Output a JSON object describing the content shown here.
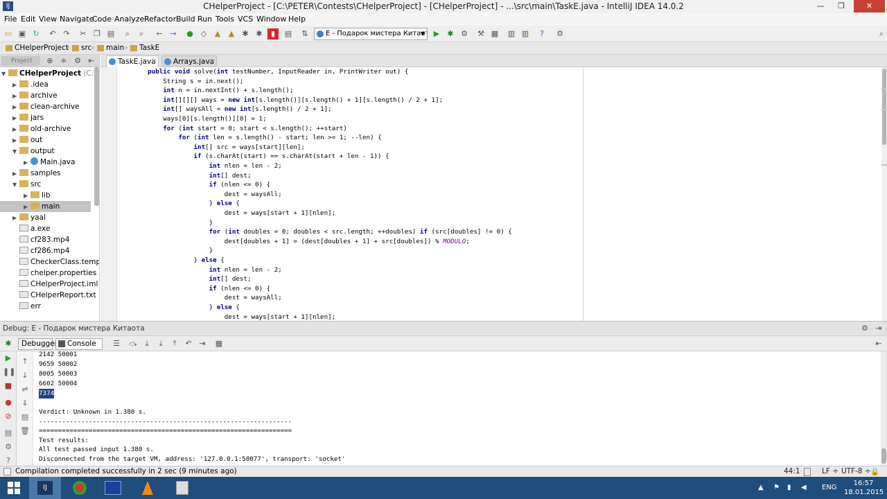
{
  "window": {
    "title": "CHelperProject - [C:\\PETER\\Contests\\CHelperProject] - [CHelperProject] - ...\\src\\main\\TaskE.java - IntelliJ IDEA 14.0.2",
    "minimize": "—",
    "maximize": "❐",
    "close": "✕"
  },
  "menu": [
    "File",
    "Edit",
    "View",
    "Navigate",
    "Code",
    "Analyze",
    "Refactor",
    "Build",
    "Run",
    "Tools",
    "VCS",
    "Window",
    "Help"
  ],
  "toolbar": {
    "run_config": "E - Подарок мистера Китаота"
  },
  "breadcrumb": [
    "CHelperProject",
    "src",
    "main",
    "TaskE"
  ],
  "project_panel": {
    "tab_label": "Project",
    "tree": [
      {
        "label": "CHelperProject",
        "suffix": "(C:\\PET",
        "type": "folder",
        "arrow": "▼"
      },
      {
        "label": ".idea",
        "type": "folder",
        "arrow": "▶"
      },
      {
        "label": "archive",
        "type": "folder",
        "arrow": "▶"
      },
      {
        "label": "clean-archive",
        "type": "folder",
        "arrow": "▶"
      },
      {
        "label": "jars",
        "type": "folder",
        "arrow": "▶"
      },
      {
        "label": "old-archive",
        "type": "folder",
        "arrow": "▶"
      },
      {
        "label": "out",
        "type": "folder",
        "arrow": "▶"
      },
      {
        "label": "output",
        "type": "folder",
        "arrow": "▼"
      },
      {
        "label": "Main.java",
        "type": "java",
        "arrow": "▶"
      },
      {
        "label": "samples",
        "type": "folder",
        "arrow": "▶"
      },
      {
        "label": "src",
        "type": "folder",
        "arrow": "▼"
      },
      {
        "label": "lib",
        "type": "folder",
        "arrow": "▶"
      },
      {
        "label": "main",
        "type": "folder",
        "arrow": "▶",
        "selected": true
      },
      {
        "label": "yaal",
        "type": "folder",
        "arrow": "▶"
      },
      {
        "label": "a.exe",
        "type": "file",
        "arrow": ""
      },
      {
        "label": "cf283.mp4",
        "type": "file",
        "arrow": ""
      },
      {
        "label": "cf286.mp4",
        "type": "file",
        "arrow": ""
      },
      {
        "label": "CheckerClass.templ",
        "type": "file",
        "arrow": ""
      },
      {
        "label": "chelper.properties",
        "type": "file",
        "arrow": ""
      },
      {
        "label": "CHelperProject.iml",
        "type": "file",
        "arrow": ""
      },
      {
        "label": "CHelperReport.txt",
        "type": "file",
        "arrow": ""
      },
      {
        "label": "err",
        "type": "file",
        "arrow": ""
      }
    ]
  },
  "editor_tabs": [
    {
      "label": "TaskE.java",
      "active": true
    },
    {
      "label": "Arrays.java",
      "active": false
    }
  ],
  "code_lines": [
    "    public void solve(int testNumber, InputReader in, PrintWriter out) {",
    "        String s = in.next();",
    "        int n = in.nextInt() + s.length();",
    "        int[][][] ways = new int[s.length()][s.length() + 1][s.length() / 2 + 1];",
    "        int[] waysAll = new int[s.length() / 2 + 1];",
    "        ways[0][s.length()][0] = 1;",
    "        for (int start = 0; start < s.length(); ++start)",
    "            for (int len = s.length() - start; len >= 1; --len) {",
    "                int[] src = ways[start][len];",
    "                if (s.charAt(start) == s.charAt(start + len - 1)) {",
    "                    int nlen = len - 2;",
    "                    int[] dest;",
    "                    if (nlen <= 0) {",
    "                        dest = waysAll;",
    "                    } else {",
    "                        dest = ways[start + 1][nlen];",
    "                    }",
    "                    for (int doubles = 0; doubles < src.length; ++doubles) if (src[doubles] != 0) {",
    "                        dest[doubles + 1] = (dest[doubles + 1] + src[doubles]) % MODULO;",
    "                    }",
    "                } else {",
    "                    int nlen = len - 2;",
    "                    int[] dest;",
    "                    if (nlen <= 0) {",
    "                        dest = waysAll;",
    "                    } else {",
    "                        dest = ways[start + 1][nlen];"
  ],
  "debug": {
    "title": "Debug",
    "config": "E - Подарок мистера Китаота",
    "tab_debugger": "Debugger",
    "tab_console": "Console",
    "console_lines": [
      "2142 50001",
      "9659 50002",
      "8005 50003",
      "6602 50004",
      "7374",
      "",
      "Verdict: Unknown in 1.380 s.",
      "------------------------------------------------------------------",
      "==================================================================",
      "Test results:",
      "All test passed input 1.380 s.",
      "Disconnected from the target VM, address: '127.0.0.1:50077', transport: 'socket'"
    ]
  },
  "status": {
    "message": "Compilation completed successfully in 2 sec (9 minutes ago)",
    "position": "44:1",
    "line_sep": "LF ÷",
    "encoding": "UTF-8 ÷"
  },
  "taskbar": {
    "lang": "ENG",
    "time": "16:57",
    "date": "18.01.2015"
  },
  "colors": {
    "keyword": "#000080",
    "constant": "#660e7a",
    "taskbar": "#1f4d7c"
  }
}
